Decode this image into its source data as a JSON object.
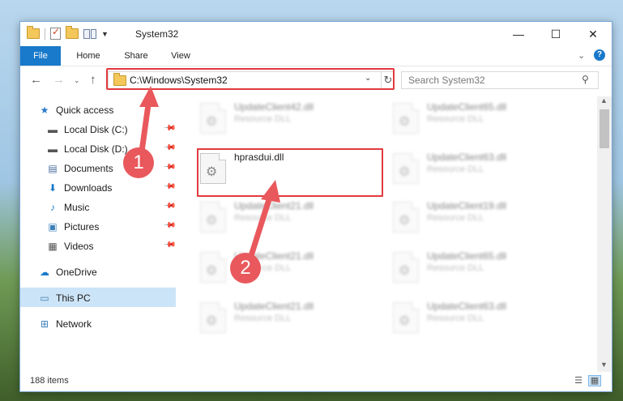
{
  "window": {
    "title": "System32",
    "controls": {
      "minimize": "—",
      "maximize": "☐",
      "close": "✕"
    }
  },
  "ribbon": {
    "tabs": [
      "File",
      "Home",
      "Share",
      "View"
    ],
    "help": "?"
  },
  "navigation": {
    "address": "C:\\Windows\\System32",
    "search_placeholder": "Search System32"
  },
  "sidebar": {
    "items": [
      {
        "label": "Quick access",
        "icon": "star-icon",
        "pinned": false
      },
      {
        "label": "Local Disk (C:)",
        "icon": "drive-icon",
        "pinned": true
      },
      {
        "label": "Local Disk (D:)",
        "icon": "drive-icon",
        "pinned": true
      },
      {
        "label": "Documents",
        "icon": "document-icon",
        "pinned": true
      },
      {
        "label": "Downloads",
        "icon": "download-icon",
        "pinned": true
      },
      {
        "label": "Music",
        "icon": "music-icon",
        "pinned": true
      },
      {
        "label": "Pictures",
        "icon": "pictures-icon",
        "pinned": true
      },
      {
        "label": "Videos",
        "icon": "video-icon",
        "pinned": true
      },
      {
        "label": "OneDrive",
        "icon": "cloud-icon",
        "pinned": false
      },
      {
        "label": "This PC",
        "icon": "computer-icon",
        "pinned": false,
        "selected": true
      },
      {
        "label": "Network",
        "icon": "network-icon",
        "pinned": false
      }
    ]
  },
  "files": {
    "highlighted": {
      "name": "hprasdui.dll"
    },
    "blurred": [
      {
        "name": "UpdateClient42.dll",
        "type": "Resource DLL"
      },
      {
        "name": "UpdateClient65.dll",
        "type": "Resource DLL"
      },
      {
        "name": "UpdateClient63.dll",
        "type": "Resource DLL"
      },
      {
        "name": "UpdateClient21.dll",
        "type": "Resource DLL"
      },
      {
        "name": "UpdateClient19.dll",
        "type": "Resource DLL"
      },
      {
        "name": "UpdateClient21.dll",
        "type": "Resource DLL"
      },
      {
        "name": "UpdateClient65.dll",
        "type": "Resource DLL"
      },
      {
        "name": "UpdateClient21.dll",
        "type": "Resource DLL"
      },
      {
        "name": "UpdateClient63.dll",
        "type": "Resource DLL"
      }
    ]
  },
  "status": {
    "count": "188 items"
  },
  "annotations": {
    "callout1": "1",
    "callout2": "2",
    "color": "#e23a3f"
  }
}
